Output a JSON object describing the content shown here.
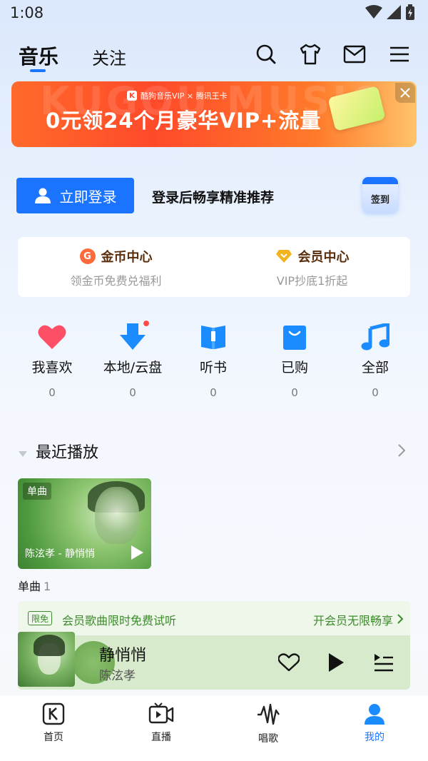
{
  "status": {
    "time": "1:08"
  },
  "header": {
    "tab_music": "音乐",
    "tab_follow": "关注"
  },
  "banner": {
    "bg_text": "KUGOU MUSIC",
    "brand": "酷狗音乐VIP × 腾讯王卡",
    "title": "0元领24个月豪华VIP+流量"
  },
  "login": {
    "button_label": "立即登录",
    "hint": "登录后畅享精准推荐",
    "signin_label": "签到"
  },
  "centers": [
    {
      "title": "金币中心",
      "subtitle": "领金币免费兑福利"
    },
    {
      "title": "会员中心",
      "subtitle": "VIP抄底1折起"
    }
  ],
  "entries": [
    {
      "label": "我喜欢",
      "count": "0"
    },
    {
      "label": "本地/云盘",
      "count": "0"
    },
    {
      "label": "听书",
      "count": "0"
    },
    {
      "label": "已购",
      "count": "0"
    },
    {
      "label": "全部",
      "count": "0"
    }
  ],
  "recent": {
    "title": "最近播放",
    "album_tag": "单曲",
    "album_caption": "陈泫孝 - 静悄悄",
    "album_label": "单曲",
    "album_count": "1"
  },
  "trial": {
    "badge": "限免",
    "text": "会员歌曲限时免费试听",
    "cta": "开会员无限畅享"
  },
  "player": {
    "title": "静悄悄",
    "artist": "陈泫孝"
  },
  "bottom_nav": [
    {
      "label": "首页"
    },
    {
      "label": "直播"
    },
    {
      "label": "唱歌"
    },
    {
      "label": "我的"
    }
  ],
  "colors": {
    "accent": "#1a74ff",
    "vip_green": "#3d8a2c"
  }
}
